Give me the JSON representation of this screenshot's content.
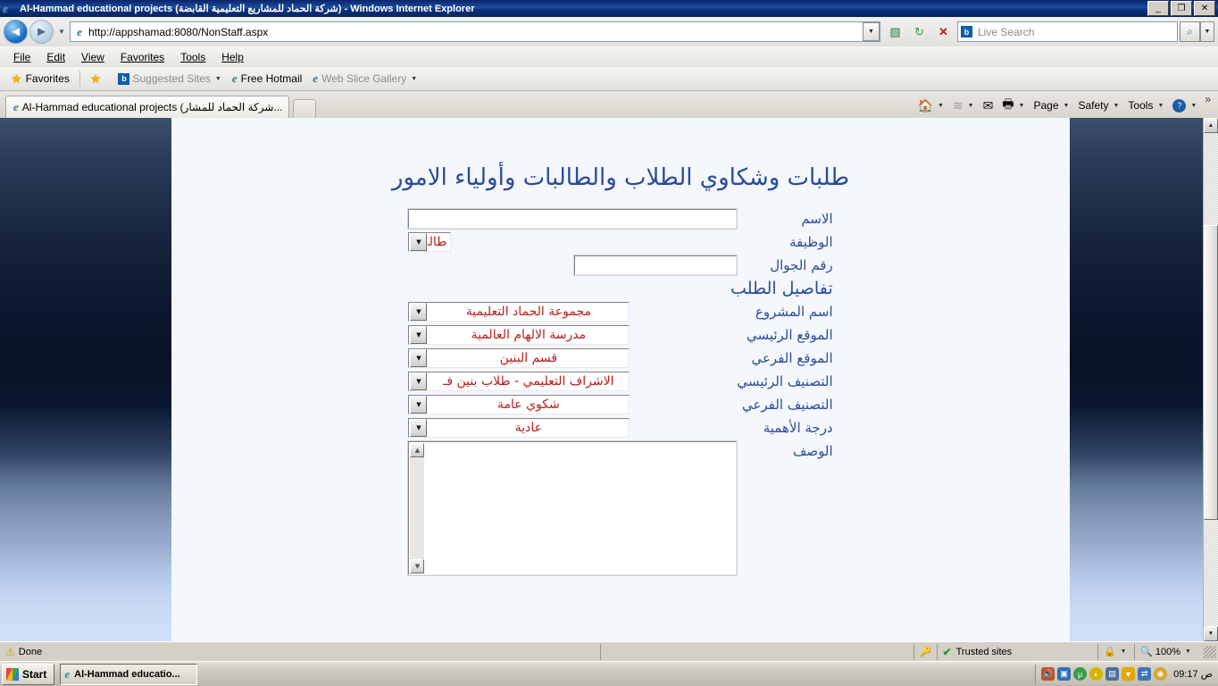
{
  "window": {
    "title": "Al-Hammad educational projects (شركة الحماد للمشاريع التعليمية القابضة) - Windows Internet Explorer",
    "minimize_label": "_",
    "maximize_label": "❐",
    "close_label": "✕"
  },
  "nav": {
    "back_label": "◄",
    "forward_label": "►",
    "history_label": "▼",
    "url": "http://appshamad:8080/NonStaff.aspx",
    "url_dropdown_label": "▼",
    "compat_label": "⛰",
    "refresh_label": "↻",
    "stop_label": "✕",
    "search_placeholder": "Live Search",
    "search_go_label": "🔍",
    "search_dropdown_label": "▼",
    "bing_label": "b"
  },
  "menu": {
    "items": [
      {
        "label": "File",
        "accel": "F"
      },
      {
        "label": "Edit",
        "accel": "E"
      },
      {
        "label": "View",
        "accel": "V"
      },
      {
        "label": "Favorites",
        "accel": "a"
      },
      {
        "label": "Tools",
        "accel": "T"
      },
      {
        "label": "Help",
        "accel": "H"
      }
    ]
  },
  "favorites_bar": {
    "favorites_label": "Favorites",
    "items": [
      {
        "label": "Suggested Sites",
        "has_caret": true,
        "dim": true
      },
      {
        "label": "Free Hotmail",
        "has_caret": false,
        "dim": false
      },
      {
        "label": "Web Slice Gallery",
        "has_caret": true,
        "dim": true
      }
    ]
  },
  "tabs": {
    "active_tab_label": "Al-Hammad educational projects (شركة الحماد للمشار...",
    "new_tab_label": ""
  },
  "command_bar": {
    "home_label": "⌂",
    "home_caret": "▼",
    "feeds_label": "📶",
    "feeds_caret": "▼",
    "mail_label": "✉",
    "print_label": "🖶",
    "print_caret": "▼",
    "page_label": "Page",
    "page_caret": "▼",
    "safety_label": "Safety",
    "safety_caret": "▼",
    "tools_label": "Tools",
    "tools_caret": "▼",
    "help_label": "?",
    "help_caret": "▼",
    "overflow_label": "»"
  },
  "page": {
    "title": "طلبات وشكاوي الطلاب والطالبات وأولياء الامور",
    "section_title": "تفاصيل الطلب",
    "fields": [
      {
        "label": "الاسم",
        "type": "text",
        "value": ""
      },
      {
        "label": "الوظيفة",
        "type": "select",
        "value": "طالب"
      },
      {
        "label": "رقم الجوال",
        "type": "text",
        "value": ""
      }
    ],
    "detail_fields": [
      {
        "label": "اسم المشروع",
        "type": "select",
        "value": "مجموعة الحماد التعليمية"
      },
      {
        "label": "الموقع الرئيسي",
        "type": "select",
        "value": "مدرسة الالهام العالمية"
      },
      {
        "label": "الموقع الفرعي",
        "type": "select",
        "value": "قسم البنين"
      },
      {
        "label": "التصنيف الرئيسي",
        "type": "select",
        "value": "الاشراف التعليمي - طلاب بنين فـ"
      },
      {
        "label": "التصنيف الفرعي",
        "type": "select",
        "value": "شكوي عامة"
      },
      {
        "label": "درجة الأهمية",
        "type": "select",
        "value": "عادية"
      }
    ],
    "description_label": "الوصف",
    "description_value": "",
    "select_arrow": "▼"
  },
  "status_bar": {
    "status_text": "Done",
    "zone_text": "Trusted sites",
    "zoom_text": "100%",
    "zone_caret": "▼",
    "zoom_caret": "▼"
  },
  "taskbar": {
    "start_label": "Start",
    "task_label": "Al-Hammad educatio...",
    "clock": "09:17 ص",
    "tray_icons": [
      {
        "name": "volume-icon",
        "glyph": "🔊",
        "color": "#c2512c"
      },
      {
        "name": "camera-icon",
        "glyph": "▣",
        "color": "#2f6fb5"
      },
      {
        "name": "utorrent-icon",
        "glyph": "μ",
        "color": "#3a9d4a"
      },
      {
        "name": "shield-icon",
        "glyph": "◐",
        "color": "#d6b400"
      },
      {
        "name": "display-icon",
        "glyph": "▤",
        "color": "#4a6f9c"
      },
      {
        "name": "usb-icon",
        "glyph": "▼",
        "color": "#e0a800"
      },
      {
        "name": "network-icon",
        "glyph": "⇄",
        "color": "#3f74b8"
      },
      {
        "name": "disc-icon",
        "glyph": "◉",
        "color": "#d9a52e"
      }
    ]
  }
}
